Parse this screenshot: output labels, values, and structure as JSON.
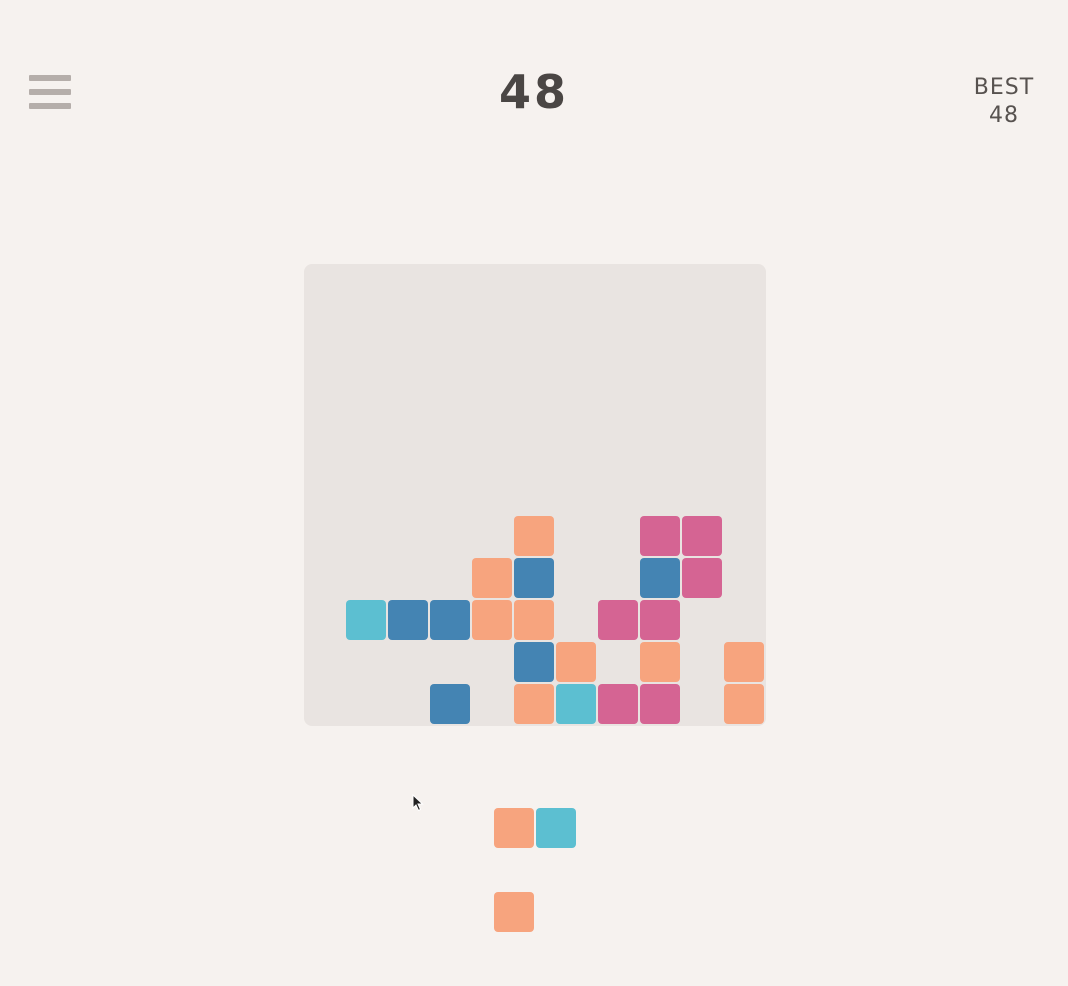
{
  "header": {
    "score": "48",
    "best_label": "BEST",
    "best_value": "48"
  },
  "colors": {
    "background": "#f6f2ef",
    "board": "#e9e4e1",
    "orange": "#f7a47e",
    "blue": "#4484b3",
    "cyan": "#5cbfd1",
    "pink": "#d56493",
    "menu_icon": "#b5aeaa",
    "score_text": "#4a4644"
  },
  "board": {
    "rows": 11,
    "cols": 11,
    "cells": [
      {
        "row": 6,
        "col": 5,
        "color": "orange"
      },
      {
        "row": 6,
        "col": 8,
        "color": "pink"
      },
      {
        "row": 6,
        "col": 9,
        "color": "pink"
      },
      {
        "row": 7,
        "col": 4,
        "color": "orange"
      },
      {
        "row": 7,
        "col": 5,
        "color": "blue"
      },
      {
        "row": 7,
        "col": 8,
        "color": "blue"
      },
      {
        "row": 7,
        "col": 9,
        "color": "pink"
      },
      {
        "row": 8,
        "col": 1,
        "color": "cyan"
      },
      {
        "row": 8,
        "col": 2,
        "color": "blue"
      },
      {
        "row": 8,
        "col": 3,
        "color": "blue"
      },
      {
        "row": 8,
        "col": 4,
        "color": "orange"
      },
      {
        "row": 8,
        "col": 5,
        "color": "orange"
      },
      {
        "row": 8,
        "col": 7,
        "color": "pink"
      },
      {
        "row": 8,
        "col": 8,
        "color": "pink"
      },
      {
        "row": 9,
        "col": 5,
        "color": "blue"
      },
      {
        "row": 9,
        "col": 6,
        "color": "orange"
      },
      {
        "row": 9,
        "col": 8,
        "color": "orange"
      },
      {
        "row": 9,
        "col": 10,
        "color": "orange"
      },
      {
        "row": 10,
        "col": 3,
        "color": "blue"
      },
      {
        "row": 10,
        "col": 5,
        "color": "orange"
      },
      {
        "row": 10,
        "col": 6,
        "color": "cyan"
      },
      {
        "row": 10,
        "col": 7,
        "color": "pink"
      },
      {
        "row": 10,
        "col": 8,
        "color": "pink"
      },
      {
        "row": 10,
        "col": 10,
        "color": "orange"
      }
    ]
  },
  "tray": {
    "pieces": [
      {
        "name": "piece-orange-cyan-pair",
        "blocks": [
          {
            "row": 0,
            "col": 0,
            "color": "orange"
          },
          {
            "row": 0,
            "col": 1,
            "color": "cyan"
          }
        ]
      },
      {
        "name": "piece-orange-single",
        "blocks": [
          {
            "row": 0,
            "col": 0,
            "color": "orange"
          }
        ]
      }
    ]
  },
  "icons": {
    "menu": "hamburger-menu-icon",
    "cursor": "mouse-pointer-icon"
  }
}
